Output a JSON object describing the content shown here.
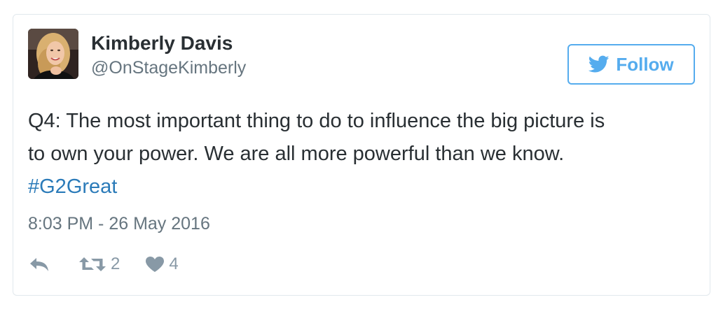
{
  "user": {
    "name": "Kimberly Davis",
    "handle": "@OnStageKimberly"
  },
  "follow_button": {
    "label": "Follow",
    "icon": "twitter-bird-icon",
    "color": "#55acee"
  },
  "tweet": {
    "text_line_1": "Q4: The most important thing to do to influence the big picture is",
    "text_line_2": "to own your power. We are all more powerful than we know.",
    "hashtag": "#G2Great",
    "timestamp": "8:03 PM - 26 May 2016"
  },
  "actions": {
    "reply_icon": "reply-icon",
    "retweet_icon": "retweet-icon",
    "retweet_count": "2",
    "like_icon": "heart-icon",
    "like_count": "4"
  },
  "colors": {
    "link": "#2b7bb9",
    "text": "#292f33",
    "muted": "#66757f",
    "action": "#8899a6",
    "border": "#e1e8ed"
  }
}
